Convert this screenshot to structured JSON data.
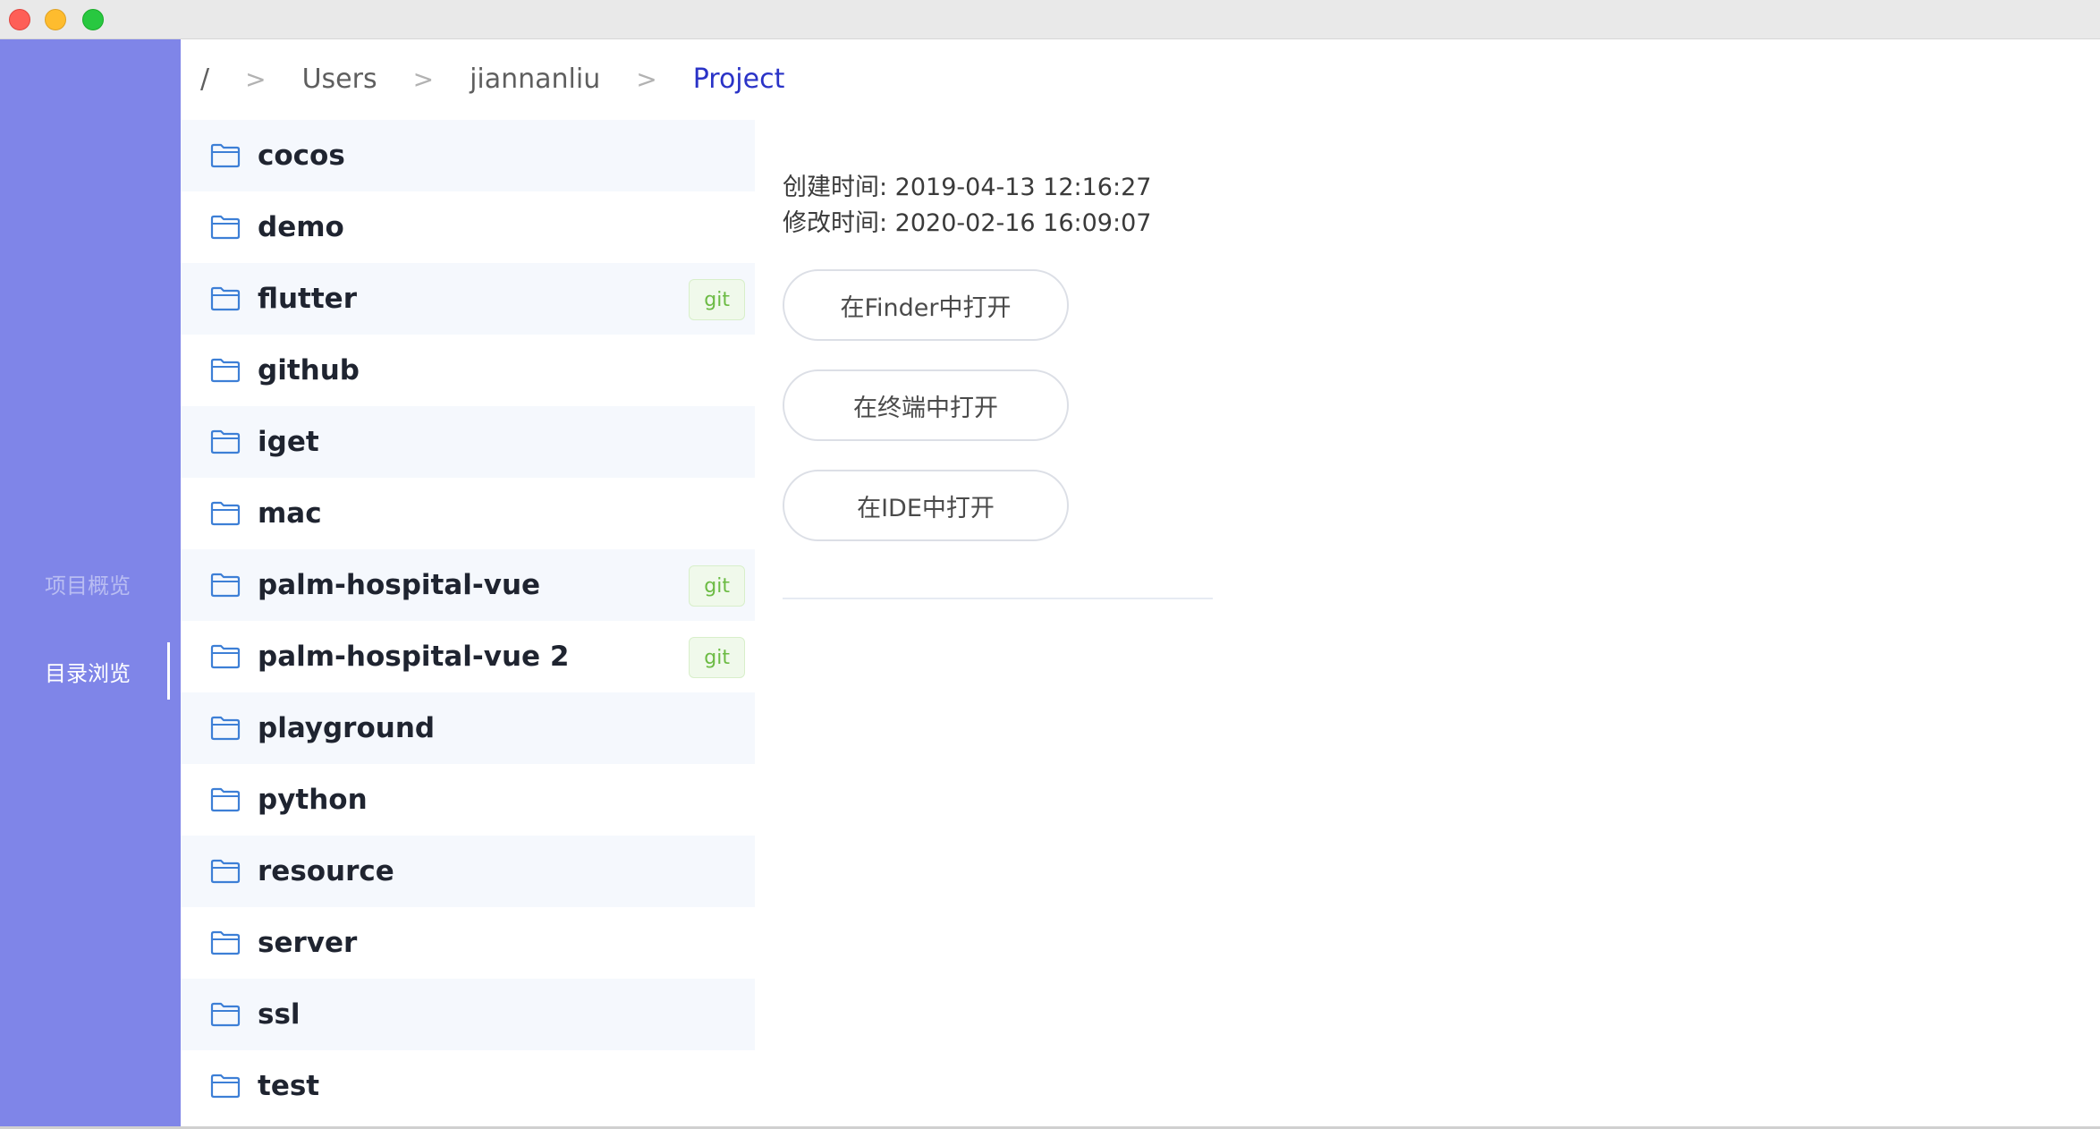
{
  "breadcrumb": {
    "root": "/",
    "separator": ">",
    "items": [
      "Users",
      "jiannanliu",
      "Project"
    ]
  },
  "sidebar": {
    "items": [
      {
        "label": "项目概览"
      },
      {
        "label": "目录浏览"
      }
    ],
    "active": "目录浏览"
  },
  "folders": [
    {
      "name": "cocos",
      "tag": ""
    },
    {
      "name": "demo",
      "tag": ""
    },
    {
      "name": "flutter",
      "tag": "git"
    },
    {
      "name": "github",
      "tag": ""
    },
    {
      "name": "iget",
      "tag": ""
    },
    {
      "name": "mac",
      "tag": ""
    },
    {
      "name": "palm-hospital-vue",
      "tag": "git"
    },
    {
      "name": "palm-hospital-vue 2",
      "tag": "git"
    },
    {
      "name": "playground",
      "tag": ""
    },
    {
      "name": "python",
      "tag": ""
    },
    {
      "name": "resource",
      "tag": ""
    },
    {
      "name": "server",
      "tag": ""
    },
    {
      "name": "ssl",
      "tag": ""
    },
    {
      "name": "test",
      "tag": ""
    }
  ],
  "details": {
    "created": "创建时间: 2019-04-13 12:16:27",
    "modified": "修改时间: 2020-02-16 16:09:07"
  },
  "actions": {
    "open_finder": "在Finder中打开",
    "open_terminal": "在终端中打开",
    "open_ide": "在IDE中打开"
  },
  "colors": {
    "sidebar": "#7f85e8",
    "accent": "#2a33c7",
    "folder_icon": "#3d7fd6",
    "git_tag": "#6cbb44"
  },
  "icons": {
    "folder": "folder-icon"
  }
}
